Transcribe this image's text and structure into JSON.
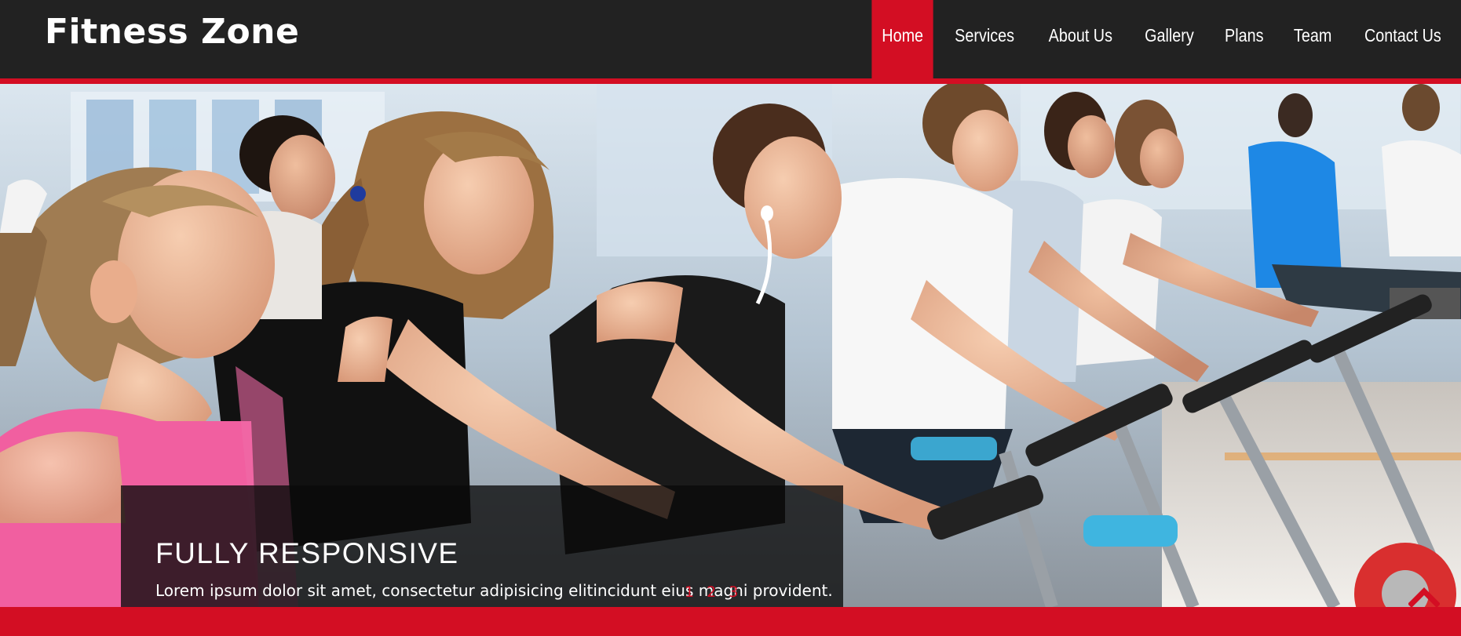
{
  "header": {
    "logo": "Fitness Zone",
    "nav": [
      {
        "label": "Home",
        "active": true
      },
      {
        "label": "Services",
        "active": false
      },
      {
        "label": "About Us",
        "active": false
      },
      {
        "label": "Gallery",
        "active": false
      },
      {
        "label": "Plans",
        "active": false
      },
      {
        "label": "Team",
        "active": false
      },
      {
        "label": "Contact Us",
        "active": false
      }
    ]
  },
  "hero": {
    "image": "people-on-spin-bikes-photo",
    "caption": {
      "title": "FULLY RESPONSIVE",
      "text": "Lorem ipsum dolor sit amet, consectetur adipisicing elitincidunt eius magni provident."
    },
    "pager": [
      "1",
      "2",
      "3"
    ],
    "scroll_top_icon": "chevron-up-icon"
  },
  "colors": {
    "accent": "#d30e23",
    "header_bg": "#222222"
  }
}
